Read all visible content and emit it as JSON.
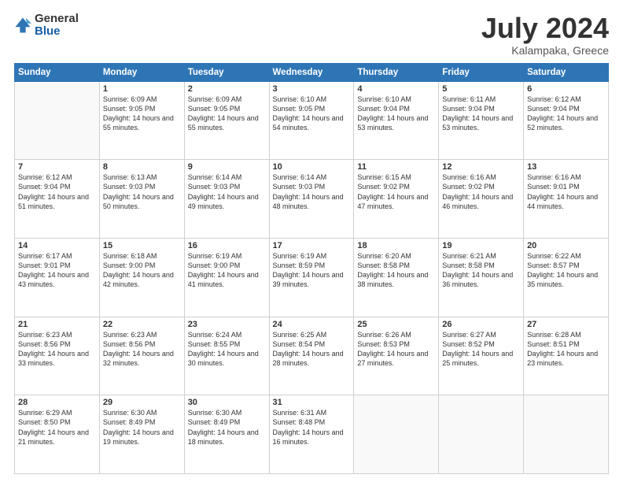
{
  "logo": {
    "general": "General",
    "blue": "Blue"
  },
  "title": "July 2024",
  "subtitle": "Kalampaka, Greece",
  "headers": [
    "Sunday",
    "Monday",
    "Tuesday",
    "Wednesday",
    "Thursday",
    "Friday",
    "Saturday"
  ],
  "weeks": [
    [
      {
        "day": "",
        "sunrise": "",
        "sunset": "",
        "daylight": ""
      },
      {
        "day": "1",
        "sunrise": "Sunrise: 6:09 AM",
        "sunset": "Sunset: 9:05 PM",
        "daylight": "Daylight: 14 hours and 55 minutes."
      },
      {
        "day": "2",
        "sunrise": "Sunrise: 6:09 AM",
        "sunset": "Sunset: 9:05 PM",
        "daylight": "Daylight: 14 hours and 55 minutes."
      },
      {
        "day": "3",
        "sunrise": "Sunrise: 6:10 AM",
        "sunset": "Sunset: 9:05 PM",
        "daylight": "Daylight: 14 hours and 54 minutes."
      },
      {
        "day": "4",
        "sunrise": "Sunrise: 6:10 AM",
        "sunset": "Sunset: 9:04 PM",
        "daylight": "Daylight: 14 hours and 53 minutes."
      },
      {
        "day": "5",
        "sunrise": "Sunrise: 6:11 AM",
        "sunset": "Sunset: 9:04 PM",
        "daylight": "Daylight: 14 hours and 53 minutes."
      },
      {
        "day": "6",
        "sunrise": "Sunrise: 6:12 AM",
        "sunset": "Sunset: 9:04 PM",
        "daylight": "Daylight: 14 hours and 52 minutes."
      }
    ],
    [
      {
        "day": "7",
        "sunrise": "Sunrise: 6:12 AM",
        "sunset": "Sunset: 9:04 PM",
        "daylight": "Daylight: 14 hours and 51 minutes."
      },
      {
        "day": "8",
        "sunrise": "Sunrise: 6:13 AM",
        "sunset": "Sunset: 9:03 PM",
        "daylight": "Daylight: 14 hours and 50 minutes."
      },
      {
        "day": "9",
        "sunrise": "Sunrise: 6:14 AM",
        "sunset": "Sunset: 9:03 PM",
        "daylight": "Daylight: 14 hours and 49 minutes."
      },
      {
        "day": "10",
        "sunrise": "Sunrise: 6:14 AM",
        "sunset": "Sunset: 9:03 PM",
        "daylight": "Daylight: 14 hours and 48 minutes."
      },
      {
        "day": "11",
        "sunrise": "Sunrise: 6:15 AM",
        "sunset": "Sunset: 9:02 PM",
        "daylight": "Daylight: 14 hours and 47 minutes."
      },
      {
        "day": "12",
        "sunrise": "Sunrise: 6:16 AM",
        "sunset": "Sunset: 9:02 PM",
        "daylight": "Daylight: 14 hours and 46 minutes."
      },
      {
        "day": "13",
        "sunrise": "Sunrise: 6:16 AM",
        "sunset": "Sunset: 9:01 PM",
        "daylight": "Daylight: 14 hours and 44 minutes."
      }
    ],
    [
      {
        "day": "14",
        "sunrise": "Sunrise: 6:17 AM",
        "sunset": "Sunset: 9:01 PM",
        "daylight": "Daylight: 14 hours and 43 minutes."
      },
      {
        "day": "15",
        "sunrise": "Sunrise: 6:18 AM",
        "sunset": "Sunset: 9:00 PM",
        "daylight": "Daylight: 14 hours and 42 minutes."
      },
      {
        "day": "16",
        "sunrise": "Sunrise: 6:19 AM",
        "sunset": "Sunset: 9:00 PM",
        "daylight": "Daylight: 14 hours and 41 minutes."
      },
      {
        "day": "17",
        "sunrise": "Sunrise: 6:19 AM",
        "sunset": "Sunset: 8:59 PM",
        "daylight": "Daylight: 14 hours and 39 minutes."
      },
      {
        "day": "18",
        "sunrise": "Sunrise: 6:20 AM",
        "sunset": "Sunset: 8:58 PM",
        "daylight": "Daylight: 14 hours and 38 minutes."
      },
      {
        "day": "19",
        "sunrise": "Sunrise: 6:21 AM",
        "sunset": "Sunset: 8:58 PM",
        "daylight": "Daylight: 14 hours and 36 minutes."
      },
      {
        "day": "20",
        "sunrise": "Sunrise: 6:22 AM",
        "sunset": "Sunset: 8:57 PM",
        "daylight": "Daylight: 14 hours and 35 minutes."
      }
    ],
    [
      {
        "day": "21",
        "sunrise": "Sunrise: 6:23 AM",
        "sunset": "Sunset: 8:56 PM",
        "daylight": "Daylight: 14 hours and 33 minutes."
      },
      {
        "day": "22",
        "sunrise": "Sunrise: 6:23 AM",
        "sunset": "Sunset: 8:56 PM",
        "daylight": "Daylight: 14 hours and 32 minutes."
      },
      {
        "day": "23",
        "sunrise": "Sunrise: 6:24 AM",
        "sunset": "Sunset: 8:55 PM",
        "daylight": "Daylight: 14 hours and 30 minutes."
      },
      {
        "day": "24",
        "sunrise": "Sunrise: 6:25 AM",
        "sunset": "Sunset: 8:54 PM",
        "daylight": "Daylight: 14 hours and 28 minutes."
      },
      {
        "day": "25",
        "sunrise": "Sunrise: 6:26 AM",
        "sunset": "Sunset: 8:53 PM",
        "daylight": "Daylight: 14 hours and 27 minutes."
      },
      {
        "day": "26",
        "sunrise": "Sunrise: 6:27 AM",
        "sunset": "Sunset: 8:52 PM",
        "daylight": "Daylight: 14 hours and 25 minutes."
      },
      {
        "day": "27",
        "sunrise": "Sunrise: 6:28 AM",
        "sunset": "Sunset: 8:51 PM",
        "daylight": "Daylight: 14 hours and 23 minutes."
      }
    ],
    [
      {
        "day": "28",
        "sunrise": "Sunrise: 6:29 AM",
        "sunset": "Sunset: 8:50 PM",
        "daylight": "Daylight: 14 hours and 21 minutes."
      },
      {
        "day": "29",
        "sunrise": "Sunrise: 6:30 AM",
        "sunset": "Sunset: 8:49 PM",
        "daylight": "Daylight: 14 hours and 19 minutes."
      },
      {
        "day": "30",
        "sunrise": "Sunrise: 6:30 AM",
        "sunset": "Sunset: 8:49 PM",
        "daylight": "Daylight: 14 hours and 18 minutes."
      },
      {
        "day": "31",
        "sunrise": "Sunrise: 6:31 AM",
        "sunset": "Sunset: 8:48 PM",
        "daylight": "Daylight: 14 hours and 16 minutes."
      },
      {
        "day": "",
        "sunrise": "",
        "sunset": "",
        "daylight": ""
      },
      {
        "day": "",
        "sunrise": "",
        "sunset": "",
        "daylight": ""
      },
      {
        "day": "",
        "sunrise": "",
        "sunset": "",
        "daylight": ""
      }
    ]
  ]
}
